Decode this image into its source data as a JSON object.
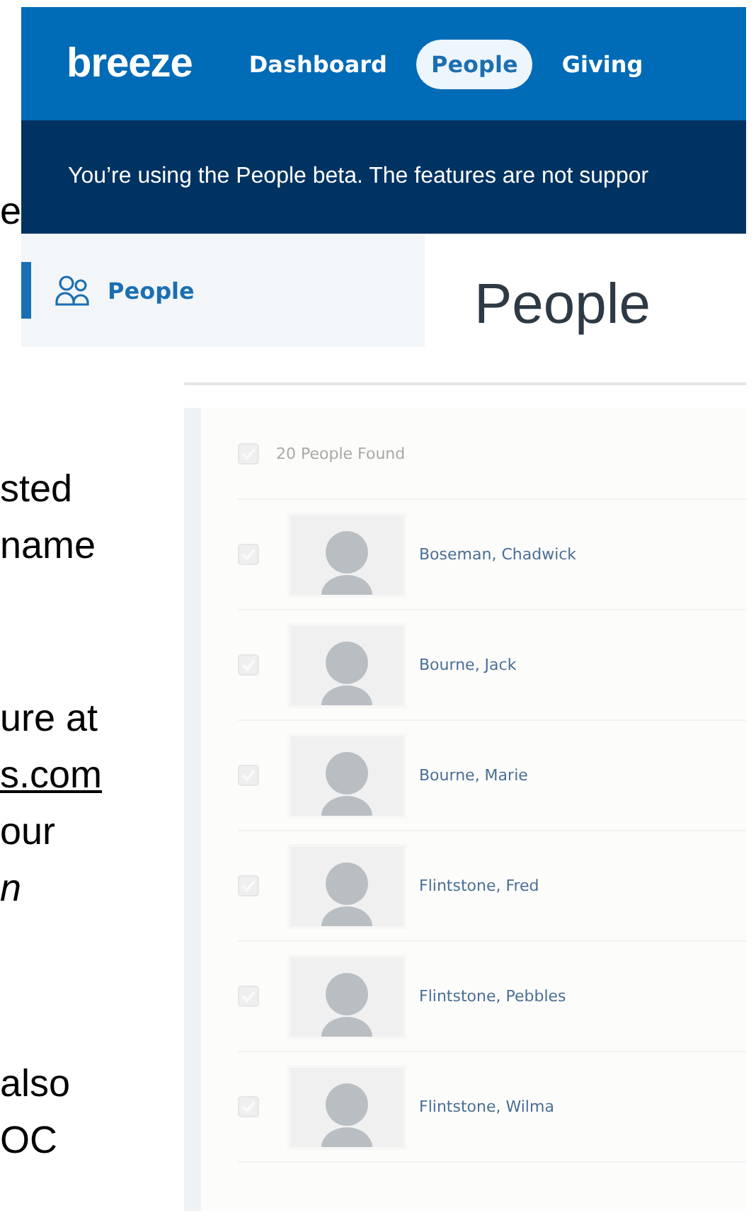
{
  "top_screen": {
    "logo": "breeze",
    "nav_tabs": [
      {
        "label": "Dashboard",
        "selected": false
      },
      {
        "label": "People",
        "selected": true
      },
      {
        "label": "Giving",
        "selected": false
      }
    ],
    "beta_banner": "You’re using the People beta. The features are not suppor",
    "sidebar": {
      "items": [
        {
          "label": "People",
          "selected": true
        }
      ]
    },
    "page_title": "People"
  },
  "list_screen": {
    "select_all_checked": false,
    "found_count": "20 People Found",
    "people": [
      {
        "name": "Boseman, Chadwick",
        "checked": false
      },
      {
        "name": "Bourne, Jack",
        "checked": false
      },
      {
        "name": "Bourne, Marie",
        "checked": false
      },
      {
        "name": "Flintstone, Fred",
        "checked": false
      },
      {
        "name": "Flintstone, Pebbles",
        "checked": false
      },
      {
        "name": "Flintstone, Wilma",
        "checked": false
      }
    ]
  },
  "document_text": {
    "paragraphs": [
      {
        "lines": [
          {
            "kind": "text",
            "text": "sted",
            "italic": false
          },
          {
            "kind": "text",
            "text": "name",
            "italic": false
          }
        ]
      },
      {
        "lines": [
          {
            "kind": "text",
            "text": "ure at",
            "italic": false
          },
          {
            "kind": "link",
            "text": "s.com",
            "italic": false
          },
          {
            "kind": "text",
            "text": "our",
            "italic": false
          },
          {
            "kind": "text",
            "text": "n",
            "italic": true
          }
        ]
      },
      {
        "lines": [
          {
            "kind": "text",
            "text": "also",
            "italic": false
          },
          {
            "kind": "text",
            "text": "OC",
            "italic": false
          }
        ]
      }
    ],
    "edge_letter": "e"
  }
}
